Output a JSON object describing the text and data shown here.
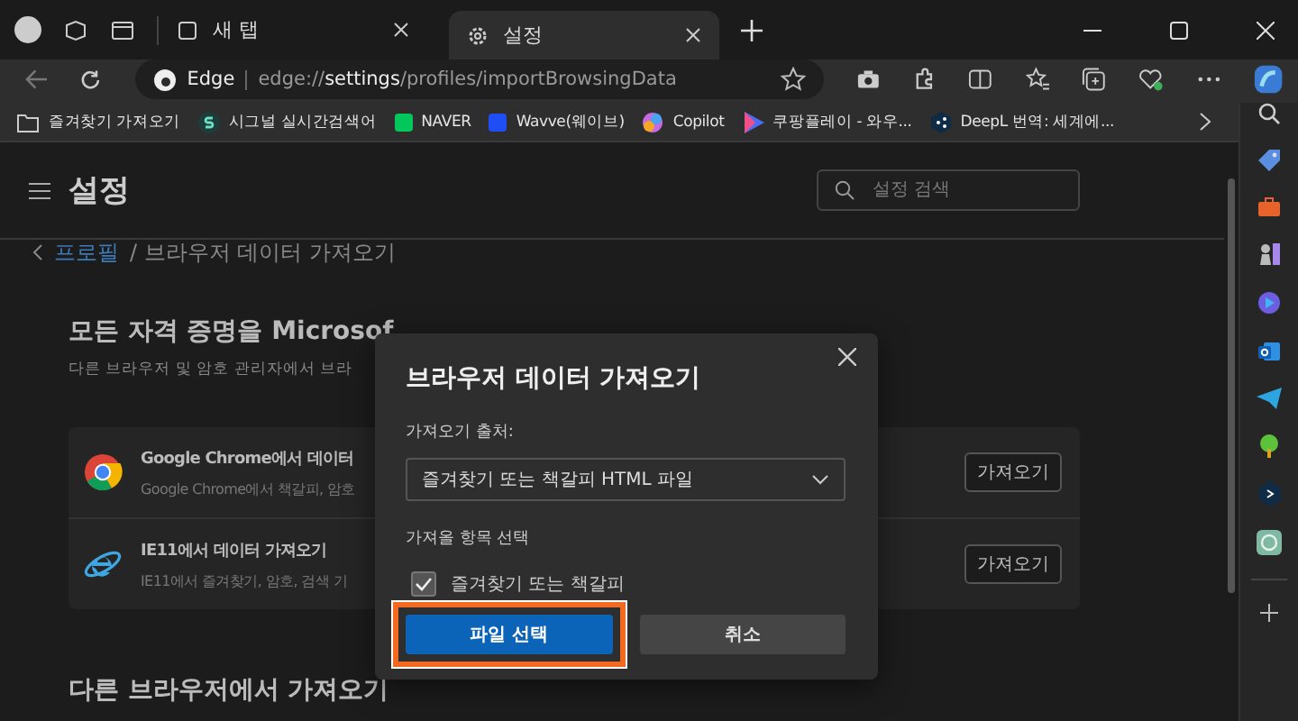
{
  "tabs": [
    {
      "label": "새 탭",
      "kind": "newtab",
      "selected": false
    },
    {
      "label": "설정",
      "kind": "settings",
      "selected": true
    }
  ],
  "address": {
    "site": "Edge",
    "url": "edge://**settings**/profiles/importBrowsingData"
  },
  "bookmarks": [
    {
      "label": "즐겨찾기 가져오기",
      "kind": "import"
    },
    {
      "label": "시그널 실시간검색어",
      "kind": "signal"
    },
    {
      "label": "NAVER",
      "kind": "naver"
    },
    {
      "label": "Wavve(웨이브)",
      "kind": "wavve"
    },
    {
      "label": "Copilot",
      "kind": "copilot"
    },
    {
      "label": "쿠팡플레이 - 와우...",
      "kind": "play"
    },
    {
      "label": "DeepL 번역: 세계에...",
      "kind": "deepl"
    }
  ],
  "settings": {
    "title": "설정",
    "search": {
      "placeholder": "설정 검색"
    },
    "breadcrumb": {
      "parent": "프로필",
      "current": "/ 브라우저 데이터 가져오기"
    },
    "section_title": "모든 자격 증명을 Microsof",
    "section_subtitle": "다른 브라우저 및 암호 관리자에서 브라",
    "sources": [
      {
        "kind": "chrome",
        "title": "Google Chrome에서 데이터",
        "detail": "Google Chrome에서 책갈피, 암호",
        "button": "가져오기"
      },
      {
        "kind": "ie",
        "title": "IE11에서 데이터 가져오기",
        "detail": "IE11에서 즐겨찾기, 암호, 검색 기",
        "button": "가져오기"
      }
    ],
    "next_section_title": "다른 브라우저에서 가져오기"
  },
  "dialog": {
    "title": "브라우저 데이터 가져오기",
    "source_label": "가져오기 출처:",
    "source_value": "즐겨찾기 또는 책갈피 HTML 파일",
    "items_label": "가져올 항목 선택",
    "items": [
      {
        "label": "즐겨찾기 또는 책갈피",
        "checked": true
      }
    ],
    "buttons": [
      {
        "label": "파일 선택",
        "kind": "primary",
        "highlighted": true
      },
      {
        "label": "취소",
        "kind": "secondary",
        "highlighted": false
      }
    ]
  }
}
